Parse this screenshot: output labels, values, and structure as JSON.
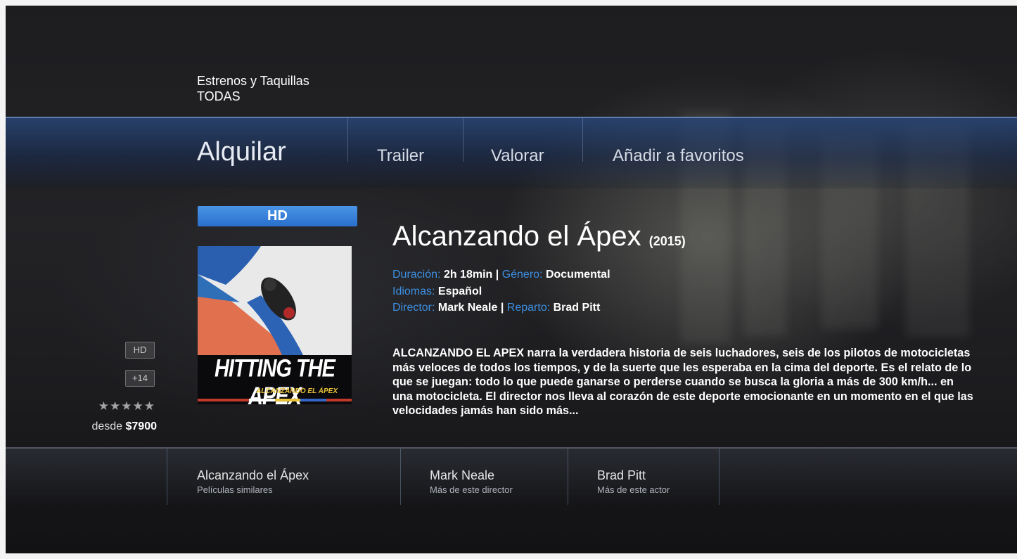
{
  "header": {
    "category": "Estrenos y Taquillas",
    "filter": "TODAS"
  },
  "actions": {
    "rent": "Alquilar",
    "trailer": "Trailer",
    "rate": "Valorar",
    "favorite": "Añadir a favoritos"
  },
  "poster": {
    "badge": "HD",
    "title": "HITTING THE APEX",
    "subtitle": "ALCANZANDO EL ÁPEX"
  },
  "movie": {
    "title": "Alcanzando el Ápex",
    "year": "(2015)",
    "duration_label": "Duración:",
    "duration": "2h 18min",
    "separator": "|",
    "genre_label": "Género:",
    "genre": "Documental",
    "languages_label": "Idiomas:",
    "languages": "Español",
    "director_label": "Director:",
    "director": "Mark Neale",
    "cast_label": "Reparto:",
    "cast": "Brad Pitt",
    "synopsis": "ALCANZANDO EL APEX narra la verdadera historia de seis luchadores, seis de los pilotos de motocicletas más veloces de todos los tiempos, y de la suerte que les esperaba en la cima del deporte. Es el relato de lo que se juegan: todo lo que puede ganarse o perderse cuando se busca la gloria a más de 300 km/h... en una motocicleta. El director nos lleva al corazón de este deporte emocionante en un momento en el que las velocidades jamás han sido más..."
  },
  "side_info": {
    "quality_badge": "HD",
    "age_badge": "+14",
    "stars": "★★★★★",
    "rating_value": 0,
    "price_prefix": "desde",
    "price": "$7900"
  },
  "related": [
    {
      "title": "Alcanzando el Ápex",
      "subtitle": "Películas similares"
    },
    {
      "title": "Mark Neale",
      "subtitle": "Más de este director"
    },
    {
      "title": "Brad Pitt",
      "subtitle": "Más de este actor"
    }
  ],
  "colors": {
    "accent_blue": "#3c8fe2",
    "hd_strip": "#2a6fcc",
    "poster_stripes": [
      "#c0392b",
      "#c0392b",
      "#ffffff",
      "#e8c23a",
      "#3466c8",
      "#c0392b"
    ]
  }
}
